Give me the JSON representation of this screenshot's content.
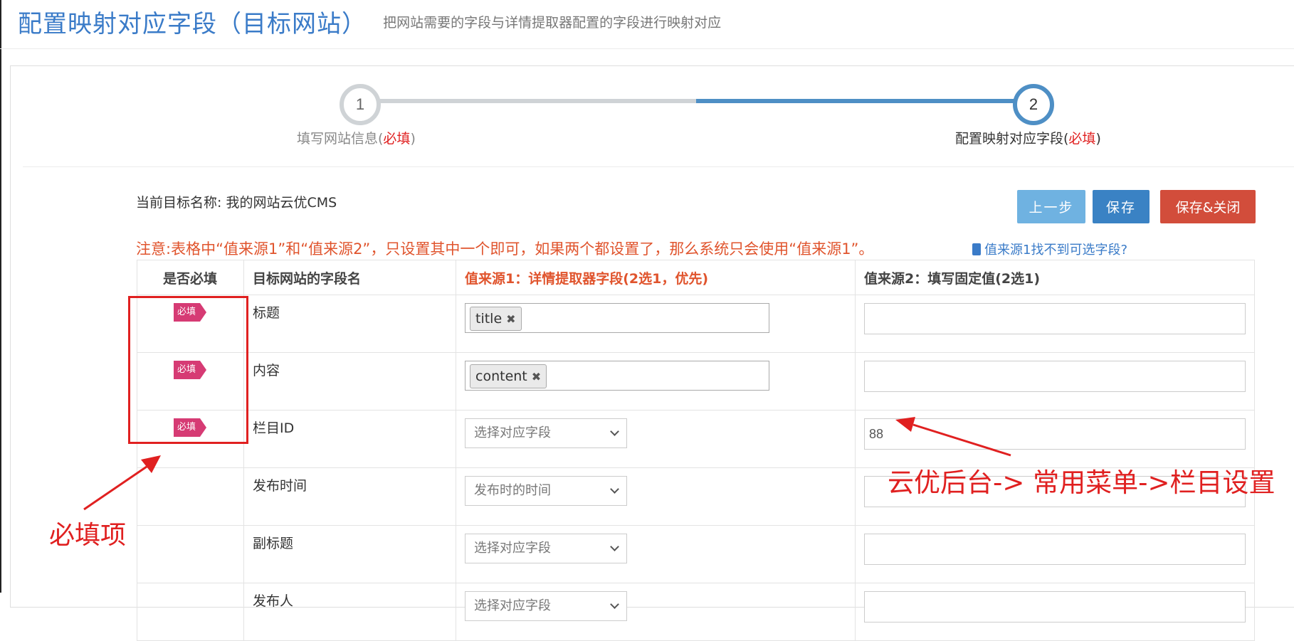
{
  "page": {
    "title": "配置映射对应字段（目标网站）",
    "subtitle": "把网站需要的字段与详情提取器配置的字段进行映射对应"
  },
  "steps": [
    {
      "number": "1",
      "label": "填写网站信息(",
      "required": "必填",
      "close": ")"
    },
    {
      "number": "2",
      "label": "配置映射对应字段(",
      "required": "必填",
      "close": ")"
    }
  ],
  "target": {
    "label": "当前目标名称: ",
    "name": "我的网站云优CMS"
  },
  "buttons": {
    "prev": "上一步",
    "save": "保存",
    "save_close": "保存&关闭"
  },
  "notice": {
    "text": "注意:表格中“值来源1”和“值来源2”，只设置其中一个即可，如果两个都设置了，那么系统只会使用“值来源1”。",
    "link": "值来源1找不到可选字段?"
  },
  "table": {
    "headers": [
      "是否必填",
      "目标网站的字段名",
      "值来源1：详情提取器字段(2选1，优先)",
      "值来源2：填写固定值(2选1)"
    ],
    "badge": "必填",
    "rows": [
      {
        "required": true,
        "field": "标题",
        "tag": "title",
        "select": "",
        "fixed": ""
      },
      {
        "required": true,
        "field": "内容",
        "tag": "content",
        "select": "",
        "fixed": ""
      },
      {
        "required": true,
        "field": "栏目ID",
        "tag": "",
        "select": "选择对应字段",
        "fixed": "88"
      },
      {
        "required": false,
        "field": "发布时间",
        "tag": "",
        "select": "发布时的时间",
        "fixed": ""
      },
      {
        "required": false,
        "field": "副标题",
        "tag": "",
        "select": "选择对应字段",
        "fixed": ""
      },
      {
        "required": false,
        "field": "发布人",
        "tag": "",
        "select": "选择对应字段",
        "fixed": ""
      }
    ]
  },
  "annotations": {
    "required_items": "必填项",
    "menu_path": "云优后台-> 常用菜单->栏目设置"
  },
  "colors": {
    "accent": "#3a7bc8",
    "danger": "#e02020",
    "badge": "#d63b74"
  }
}
